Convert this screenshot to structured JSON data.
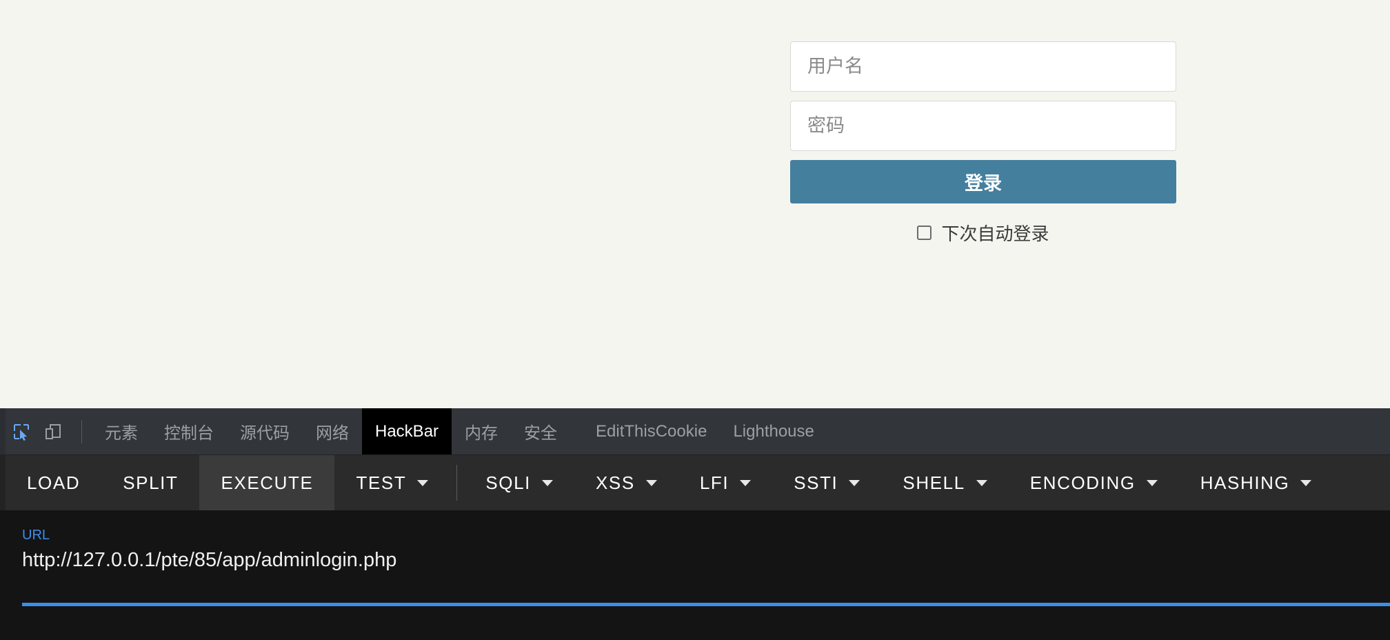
{
  "page": {
    "background_color": "#f5f5f0",
    "login": {
      "username_placeholder": "用户名",
      "username_value": "",
      "password_placeholder": "密码",
      "password_value": "",
      "submit_label": "登录",
      "submit_color": "#447f9e",
      "remember_label": "下次自动登录",
      "remember_checked": false
    }
  },
  "devtools": {
    "inspect_icon": "inspect-element-icon",
    "device_icon": "device-toolbar-icon",
    "inspect_icon_color": "#6aa9f4",
    "tabs": [
      {
        "label": "元素",
        "active": false
      },
      {
        "label": "控制台",
        "active": false
      },
      {
        "label": "源代码",
        "active": false
      },
      {
        "label": "网络",
        "active": false
      },
      {
        "label": "HackBar",
        "active": true
      },
      {
        "label": "内存",
        "active": false
      },
      {
        "label": "安全",
        "active": false
      },
      {
        "label": "EditThisCookie",
        "active": false
      },
      {
        "label": "Lighthouse",
        "active": false
      }
    ],
    "hackbar": {
      "buttons": [
        {
          "label": "LOAD",
          "caret": false,
          "highlight": false
        },
        {
          "label": "SPLIT",
          "caret": false,
          "highlight": false
        },
        {
          "label": "EXECUTE",
          "caret": false,
          "highlight": true
        },
        {
          "label": "TEST",
          "caret": true,
          "highlight": false
        },
        {
          "label": "SQLI",
          "caret": true,
          "highlight": false
        },
        {
          "label": "XSS",
          "caret": true,
          "highlight": false
        },
        {
          "label": "LFI",
          "caret": true,
          "highlight": false
        },
        {
          "label": "SSTI",
          "caret": true,
          "highlight": false
        },
        {
          "label": "SHELL",
          "caret": true,
          "highlight": false
        },
        {
          "label": "ENCODING",
          "caret": true,
          "highlight": false
        },
        {
          "label": "HASHING",
          "caret": true,
          "highlight": false
        }
      ],
      "url_label": "URL",
      "url_value": "http://127.0.0.1/pte/85/app/adminlogin.php",
      "accent_color": "#3b8eea"
    }
  }
}
